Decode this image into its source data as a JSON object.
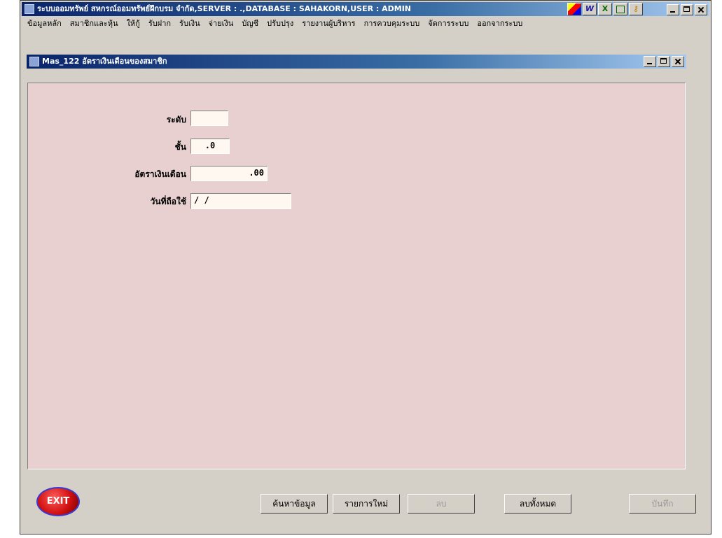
{
  "app": {
    "title": "ระบบออมทรัพย์ สหกรณ์ออมทรัพย์ฝึกบรม จำกัด,SERVER : .,DATABASE : SAHAKORN,USER : ADMIN"
  },
  "toolbar_icons": [
    "grid-icon",
    "word-icon",
    "excel-icon",
    "window-icon",
    "key-icon"
  ],
  "menu": [
    "ข้อมูลหลัก",
    "สมาชิกและหุ้น",
    "ให้กู้",
    "รับฝาก",
    "รับเงิน",
    "จ่ายเงิน",
    "บัญชี",
    "ปรับปรุง",
    "รายงานผู้บริหาร",
    "การควบคุมระบบ",
    "จัดการระบบ",
    "ออกจากระบบ"
  ],
  "child_window": {
    "title": "Mas_122 อัตราเงินเดือนของสมาชิก"
  },
  "form": {
    "level": {
      "label": "ระดับ",
      "value": ""
    },
    "step": {
      "label": "ชั้น",
      "value": ".0"
    },
    "salary_rate": {
      "label": "อัตราเงินเดือน",
      "value": ".00"
    },
    "effective_date": {
      "label": "วันที่ถือใช้",
      "value": "/ /"
    }
  },
  "buttons": {
    "exit": "EXIT",
    "search": "ค้นหาข้อมูล",
    "new": "รายการใหม่",
    "delete": "ลบ",
    "delete_all": "ลบทั้งหมด",
    "save": "บันทึก"
  }
}
